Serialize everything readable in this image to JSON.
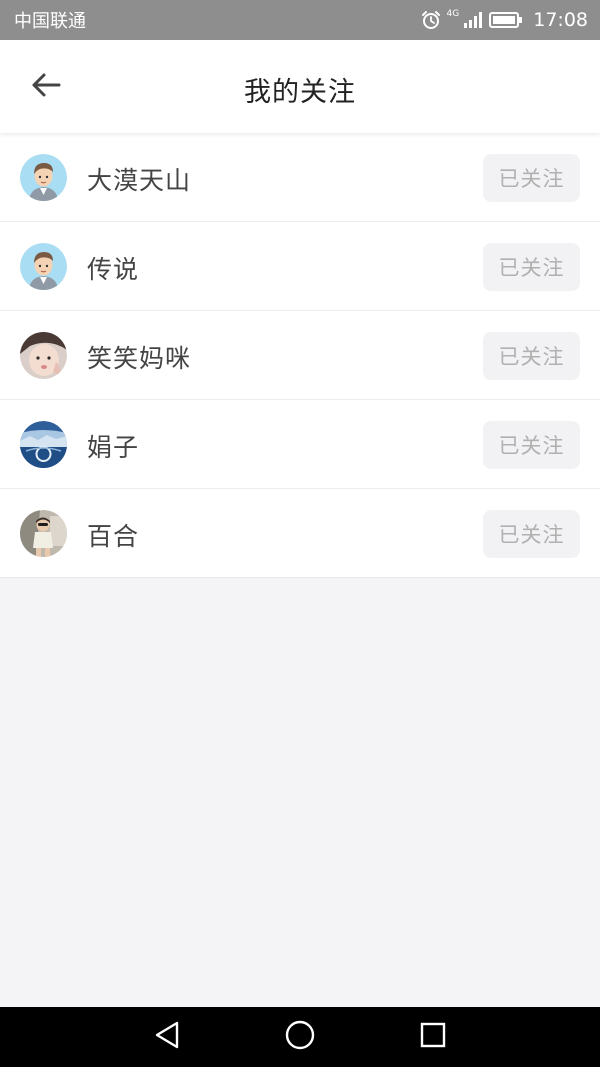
{
  "status_bar": {
    "carrier": "中国联通",
    "network": "4G",
    "time": "17:08",
    "icons": [
      "alarm-icon",
      "signal-icon",
      "battery-icon"
    ]
  },
  "header": {
    "title": "我的关注",
    "back_icon": "arrow-left-icon"
  },
  "following": [
    {
      "name": "大漠天山",
      "button_label": "已关注",
      "avatar": "cartoon-man-avatar"
    },
    {
      "name": "传说",
      "button_label": "已关注",
      "avatar": "cartoon-man-avatar"
    },
    {
      "name": "笑笑妈咪",
      "button_label": "已关注",
      "avatar": "baby-photo-avatar"
    },
    {
      "name": "娟子",
      "button_label": "已关注",
      "avatar": "landscape-photo-avatar"
    },
    {
      "name": "百合",
      "button_label": "已关注",
      "avatar": "child-photo-avatar"
    }
  ],
  "nav_bar": {
    "back": "triangle-back-icon",
    "home": "circle-home-icon",
    "recents": "square-recents-icon"
  },
  "colors": {
    "status_bar_bg": "#8e8e8e",
    "page_bg": "#f4f4f6",
    "button_bg": "#f2f2f4",
    "button_text": "#b0b0b0",
    "name_text": "#444444"
  }
}
